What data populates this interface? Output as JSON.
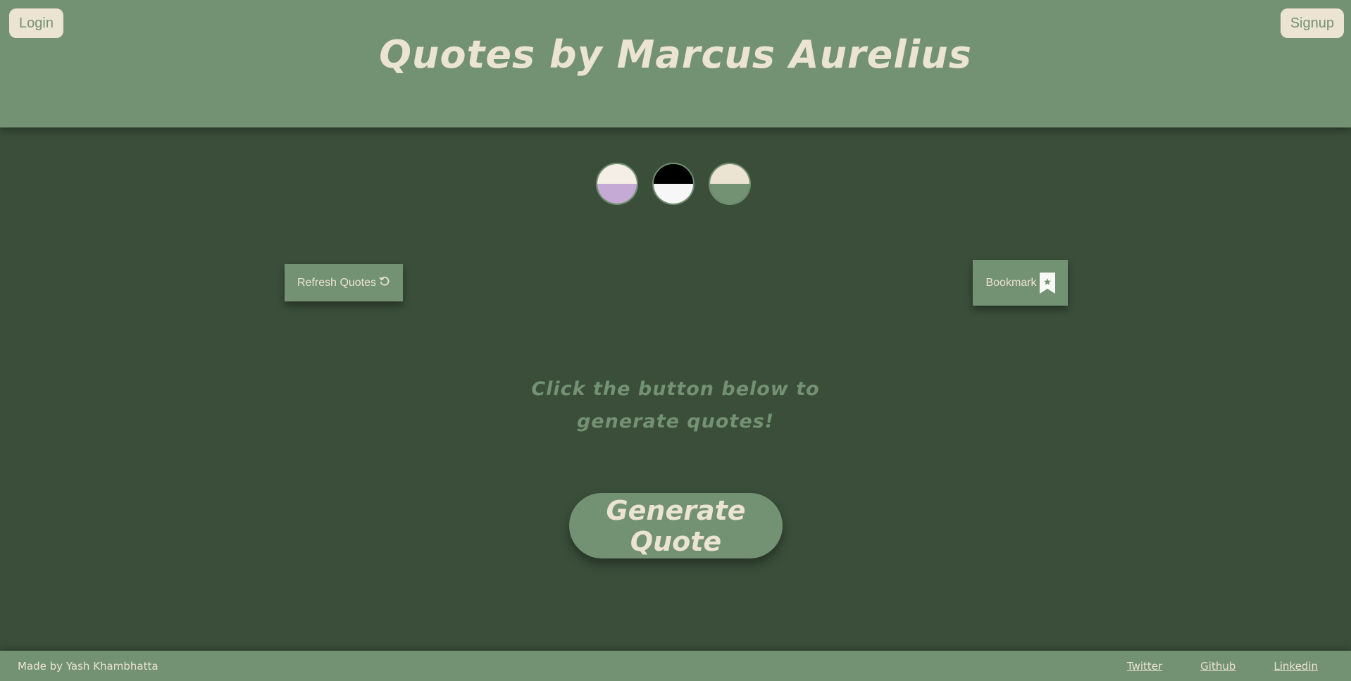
{
  "header": {
    "title": "Quotes by Marcus Aurelius",
    "login_label": "Login",
    "signup_label": "Signup"
  },
  "themes": [
    {
      "name": "cream-lavender",
      "top": "#f5eee6",
      "bottom": "#c5aad5"
    },
    {
      "name": "black-white",
      "top": "#000000",
      "bottom": "#f6f7f6"
    },
    {
      "name": "beige-sage",
      "top": "#ece4d2",
      "bottom": "#739173"
    }
  ],
  "actions": {
    "refresh_label": "Refresh Quotes",
    "refresh_icon": "refresh-icon",
    "bookmark_label": "Bookmark",
    "bookmark_icon": "bookmark-star-icon"
  },
  "main": {
    "prompt": "Click the button below to generate quotes!",
    "generate_label": "Generate Quote"
  },
  "footer": {
    "made_by": "Made by Yash Khambhatta",
    "links": [
      "Twitter",
      "Github",
      "Linkedin"
    ]
  },
  "colors": {
    "background": "#3a4e3a",
    "accent": "#739173",
    "cream": "#ece4d2"
  }
}
